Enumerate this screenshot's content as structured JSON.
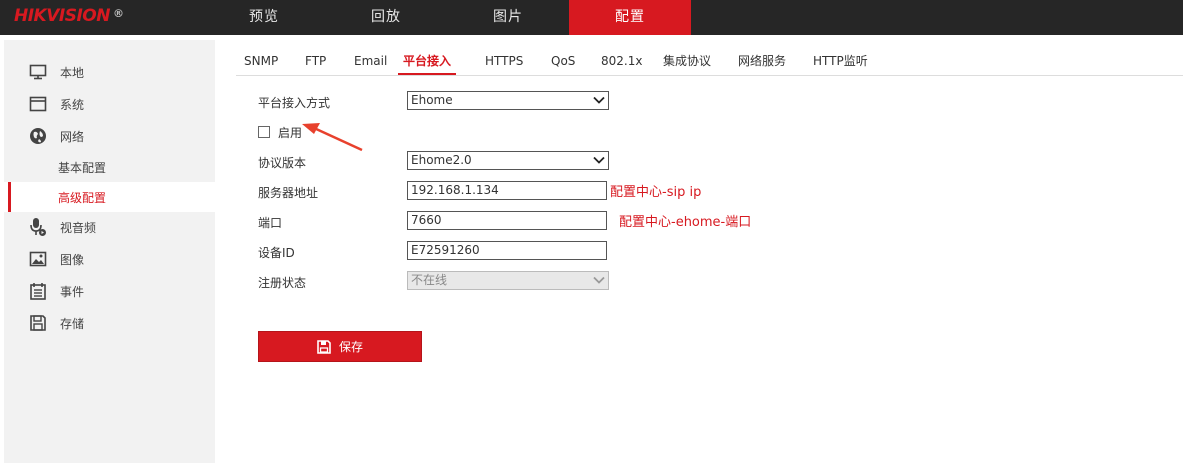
{
  "header": {
    "logo": "HIKVISION",
    "logo_mark": "®",
    "nav": [
      {
        "label": "预览"
      },
      {
        "label": "回放"
      },
      {
        "label": "图片"
      },
      {
        "label": "配置"
      }
    ],
    "active_nav": "配置"
  },
  "sidebar": {
    "items": [
      {
        "label": "本地",
        "icon": "monitor-icon"
      },
      {
        "label": "系统",
        "icon": "window-icon"
      },
      {
        "label": "网络",
        "icon": "globe-icon"
      },
      {
        "label": "基本配置"
      },
      {
        "label": "高级配置"
      },
      {
        "label": "视音频",
        "icon": "microphone-icon"
      },
      {
        "label": "图像",
        "icon": "image-icon"
      },
      {
        "label": "事件",
        "icon": "calendar-icon"
      },
      {
        "label": "存储",
        "icon": "floppy-icon"
      }
    ],
    "active_item": "高级配置"
  },
  "tabs": {
    "items": [
      {
        "label": "SNMP"
      },
      {
        "label": "FTP"
      },
      {
        "label": "Email"
      },
      {
        "label": "平台接入"
      },
      {
        "label": "HTTPS"
      },
      {
        "label": "QoS"
      },
      {
        "label": "802.1x"
      },
      {
        "label": "集成协议"
      },
      {
        "label": "网络服务"
      },
      {
        "label": "HTTP监听"
      }
    ],
    "active": "平台接入"
  },
  "form": {
    "access_mode_label": "平台接入方式",
    "access_mode_value": "Ehome",
    "enable_label": "启用",
    "enable_checked": false,
    "protocol_version_label": "协议版本",
    "protocol_version_value": "Ehome2.0",
    "server_address_label": "服务器地址",
    "server_address_value": "192.168.1.134",
    "server_address_note": "配置中心-sip  ip",
    "port_label": "端口",
    "port_value": "7660",
    "port_note": "配置中心-ehome-端口",
    "device_id_label": "设备ID",
    "device_id_value": "E72591260",
    "register_status_label": "注册状态",
    "register_status_value": "不在线"
  },
  "actions": {
    "save_label": "保存"
  },
  "colors": {
    "brand_red": "#d71920",
    "topbar_bg": "#262626",
    "sidebar_bg": "#f2f2f2"
  }
}
